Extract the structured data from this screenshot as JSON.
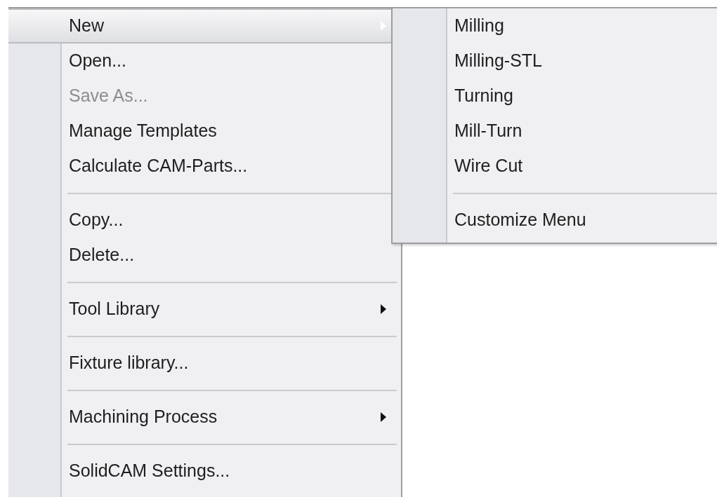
{
  "menu": {
    "items": [
      {
        "kind": "item",
        "label": "New",
        "selected": true,
        "disabled": false,
        "has_submenu": true
      },
      {
        "kind": "item",
        "label": "Open...",
        "selected": false,
        "disabled": false,
        "has_submenu": false
      },
      {
        "kind": "item",
        "label": "Save As...",
        "selected": false,
        "disabled": true,
        "has_submenu": false
      },
      {
        "kind": "item",
        "label": "Manage Templates",
        "selected": false,
        "disabled": false,
        "has_submenu": false
      },
      {
        "kind": "item",
        "label": "Calculate CAM-Parts...",
        "selected": false,
        "disabled": false,
        "has_submenu": false
      },
      {
        "kind": "separator"
      },
      {
        "kind": "item",
        "label": "Copy...",
        "selected": false,
        "disabled": false,
        "has_submenu": false
      },
      {
        "kind": "item",
        "label": "Delete...",
        "selected": false,
        "disabled": false,
        "has_submenu": false
      },
      {
        "kind": "separator"
      },
      {
        "kind": "item",
        "label": "Tool Library",
        "selected": false,
        "disabled": false,
        "has_submenu": true
      },
      {
        "kind": "separator"
      },
      {
        "kind": "item",
        "label": "Fixture library...",
        "selected": false,
        "disabled": false,
        "has_submenu": false
      },
      {
        "kind": "separator"
      },
      {
        "kind": "item",
        "label": "Machining Process",
        "selected": false,
        "disabled": false,
        "has_submenu": true
      },
      {
        "kind": "separator"
      },
      {
        "kind": "item",
        "label": "SolidCAM Settings...",
        "selected": false,
        "disabled": false,
        "has_submenu": false
      }
    ]
  },
  "submenu": {
    "items": [
      {
        "kind": "item",
        "label": "Milling",
        "selected": false,
        "disabled": false,
        "has_submenu": false
      },
      {
        "kind": "item",
        "label": "Milling-STL",
        "selected": false,
        "disabled": false,
        "has_submenu": false
      },
      {
        "kind": "item",
        "label": "Turning",
        "selected": false,
        "disabled": false,
        "has_submenu": false
      },
      {
        "kind": "item",
        "label": "Mill-Turn",
        "selected": false,
        "disabled": false,
        "has_submenu": false
      },
      {
        "kind": "item",
        "label": "Wire Cut",
        "selected": false,
        "disabled": false,
        "has_submenu": false
      },
      {
        "kind": "separator"
      },
      {
        "kind": "item",
        "label": "Customize Menu",
        "selected": false,
        "disabled": false,
        "has_submenu": false
      }
    ]
  }
}
